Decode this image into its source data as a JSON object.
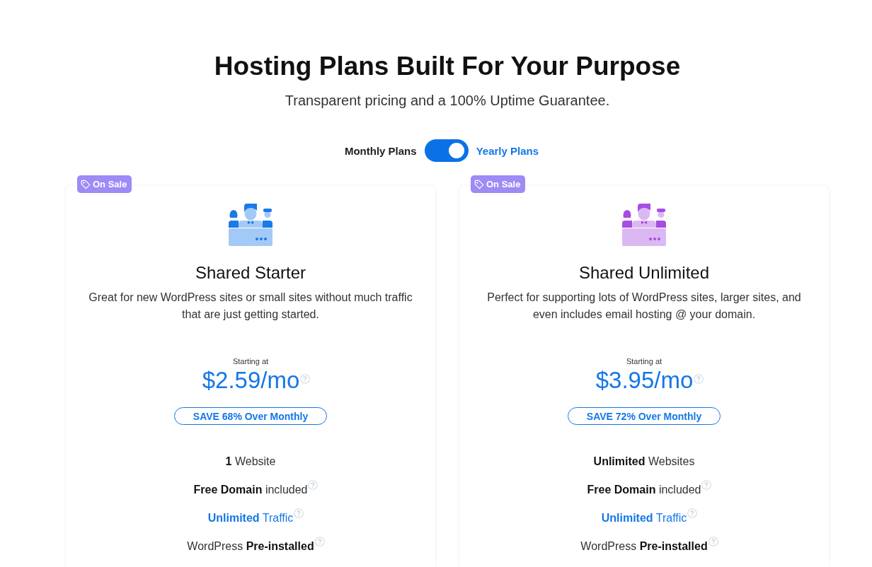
{
  "header": {
    "title": "Hosting Plans Built For Your Purpose",
    "subtitle": "Transparent pricing and a 100% Uptime Guarantee."
  },
  "billing_toggle": {
    "left_label": "Monthly Plans",
    "right_label": "Yearly Plans",
    "on": true
  },
  "plans": [
    {
      "badge": "On Sale",
      "color": "#1a7ae8",
      "name": "Shared Starter",
      "description": "Great for new WordPress sites or small sites without much traffic that are just getting started.",
      "price_label": "Starting at",
      "price": "$2.59/mo",
      "price_help": true,
      "savings": "SAVE 68% Over Monthly",
      "features": [
        {
          "text": "**1** Website",
          "kind": "plain",
          "help": false
        },
        {
          "text": "**Free Domain** included",
          "kind": "plain",
          "help": true
        },
        {
          "text": "**Unlimited** Traffic",
          "kind": "link",
          "help": true
        },
        {
          "text": "WordPress **Pre-installed**",
          "kind": "plain",
          "help": true
        }
      ]
    },
    {
      "badge": "On Sale",
      "color": "#a54ee0",
      "name": "Shared Unlimited",
      "description": "Perfect for supporting lots of WordPress sites, larger sites, and even includes email hosting @ your domain.",
      "price_label": "Starting at",
      "price": "$3.95/mo",
      "price_help": true,
      "savings": "SAVE 72% Over Monthly",
      "features": [
        {
          "text": "**Unlimited** Websites",
          "kind": "plain",
          "help": false
        },
        {
          "text": "**Free Domain** included",
          "kind": "plain",
          "help": true
        },
        {
          "text": "**Unlimited** Traffic",
          "kind": "link",
          "help": true
        },
        {
          "text": "WordPress **Pre-installed**",
          "kind": "plain",
          "help": true
        }
      ]
    }
  ]
}
